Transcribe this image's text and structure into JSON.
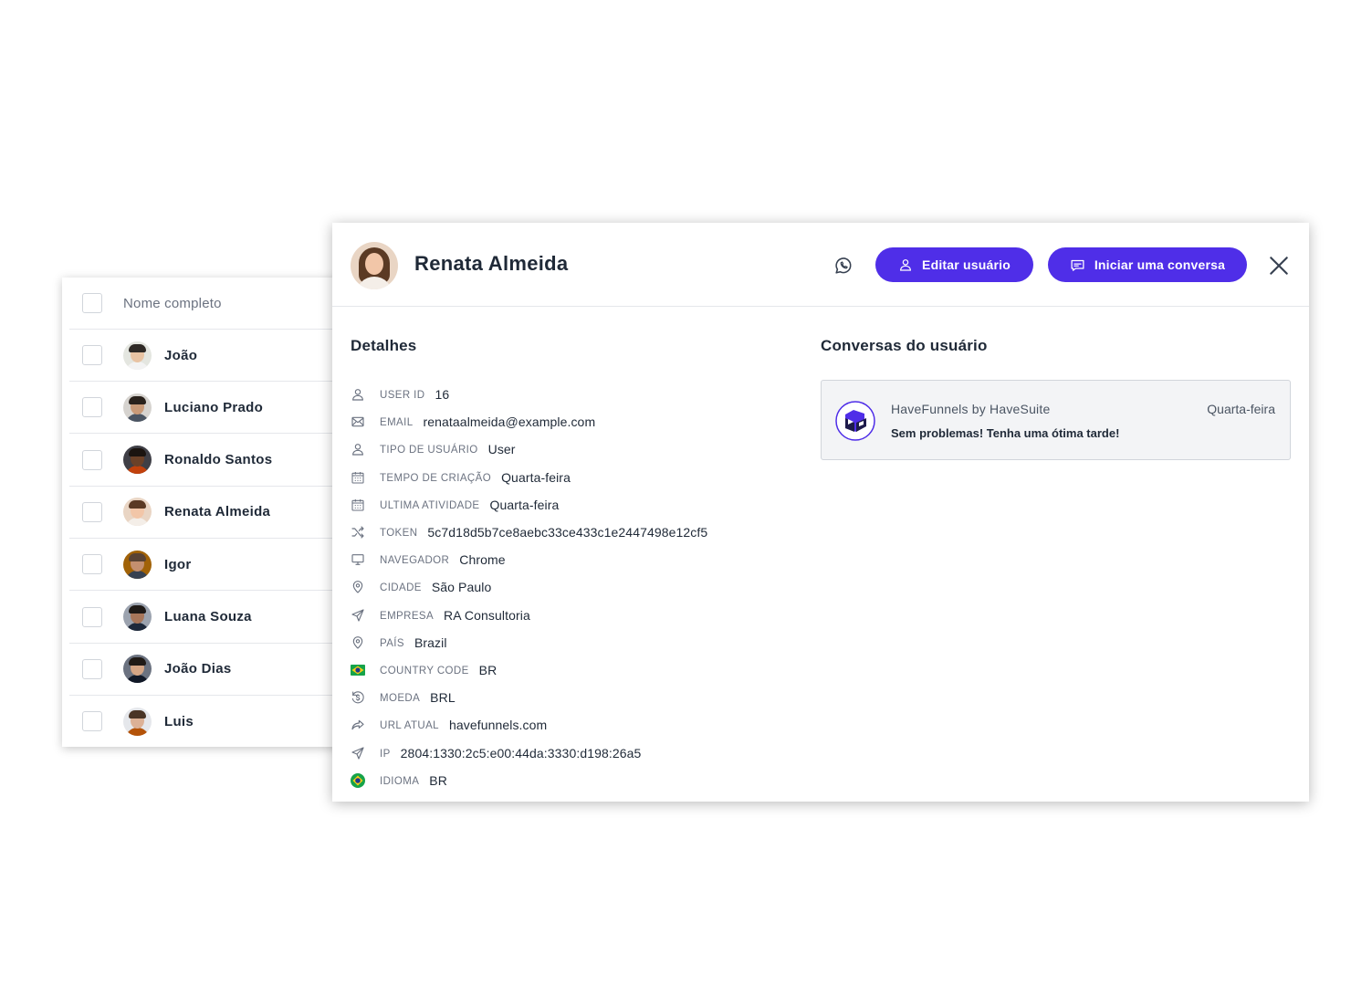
{
  "list": {
    "header_label": "Nome completo",
    "rows": [
      {
        "name": "João",
        "skin": "#e8c3a3",
        "hair": "#2f2a26",
        "bg": "#e4e6e0",
        "shirt": "#f3f3f3"
      },
      {
        "name": "Luciano Prado",
        "skin": "#c99a78",
        "hair": "#2a221c",
        "bg": "#d6d3cf",
        "shirt": "#4b5563"
      },
      {
        "name": "Ronaldo Santos",
        "skin": "#6b4128",
        "hair": "#1b1410",
        "bg": "#3f3f46",
        "shirt": "#c2410c"
      },
      {
        "name": "Renata Almeida",
        "skin": "#f2c6a8",
        "hair": "#5b3a24",
        "bg": "#e9d5c4",
        "shirt": "#f4eee8"
      },
      {
        "name": "Igor",
        "skin": "#c48f6f",
        "hair": "#5a4334",
        "bg": "#a16207",
        "shirt": "#374151"
      },
      {
        "name": "Luana Souza",
        "skin": "#a8765a",
        "hair": "#1f1a17",
        "bg": "#9ca3af",
        "shirt": "#1e293b"
      },
      {
        "name": "João Dias",
        "skin": "#d4a585",
        "hair": "#201a16",
        "bg": "#6b7280",
        "shirt": "#111827"
      },
      {
        "name": "Luis",
        "skin": "#dcb196",
        "hair": "#4a3526",
        "bg": "#e5e7eb",
        "shirt": "#b45309"
      }
    ]
  },
  "modal": {
    "user_name": "Renata Almeida",
    "edit_label": "Editar usuário",
    "chat_label": "Iniciar uma conversa",
    "details_title": "Detalhes",
    "conversations_title": "Conversas do usuário",
    "details": [
      {
        "icon": "user-icon",
        "label": "USER ID",
        "value": "16"
      },
      {
        "icon": "mail-icon",
        "label": "EMAIL",
        "value": "renataalmeida@example.com"
      },
      {
        "icon": "user-icon",
        "label": "TIPO DE USUÁRIO",
        "value": "User"
      },
      {
        "icon": "calendar-icon",
        "label": "TEMPO DE CRIAÇÃO",
        "value": "Quarta-feira"
      },
      {
        "icon": "calendar-icon",
        "label": "ULTIMA ATIVIDADE",
        "value": "Quarta-feira"
      },
      {
        "icon": "shuffle-icon",
        "label": "TOKEN",
        "value": "5c7d18d5b7ce8aebc33ce433c1e2447498e12cf5"
      },
      {
        "icon": "monitor-icon",
        "label": "NAVEGADOR",
        "value": "Chrome"
      },
      {
        "icon": "location-pin-icon",
        "label": "CIDADE",
        "value": "São Paulo"
      },
      {
        "icon": "send-icon",
        "label": "EMPRESA",
        "value": "RA Consultoria"
      },
      {
        "icon": "location-pin-icon",
        "label": "PAÍS",
        "value": "Brazil"
      },
      {
        "icon": "brazil-flag-icon",
        "label": "COUNTRY CODE",
        "value": "BR"
      },
      {
        "icon": "currency-icon",
        "label": "MOEDA",
        "value": "BRL"
      },
      {
        "icon": "share-arrow-icon",
        "label": "URL ATUAL",
        "value": "havefunnels.com"
      },
      {
        "icon": "send-icon",
        "label": "IP",
        "value": "2804:1330:2c5:e00:44da:3330:d198:26a5"
      },
      {
        "icon": "brazil-round-flag-icon",
        "label": "IDIOMA",
        "value": "BR"
      }
    ],
    "conversation": {
      "name": "HaveFunnels by HaveSuite",
      "day": "Quarta-feira",
      "message": "Sem problemas! Tenha uma ótima tarde!"
    }
  },
  "colors": {
    "primary": "#4f2ee8",
    "label": "#6b7280",
    "text": "#1f2937",
    "icon": "#6b7280",
    "whatsapp_icon": "#374151",
    "brazil_green": "#16a34a",
    "brazil_yellow": "#facc15",
    "brazil_blue": "#1e3a8a"
  }
}
